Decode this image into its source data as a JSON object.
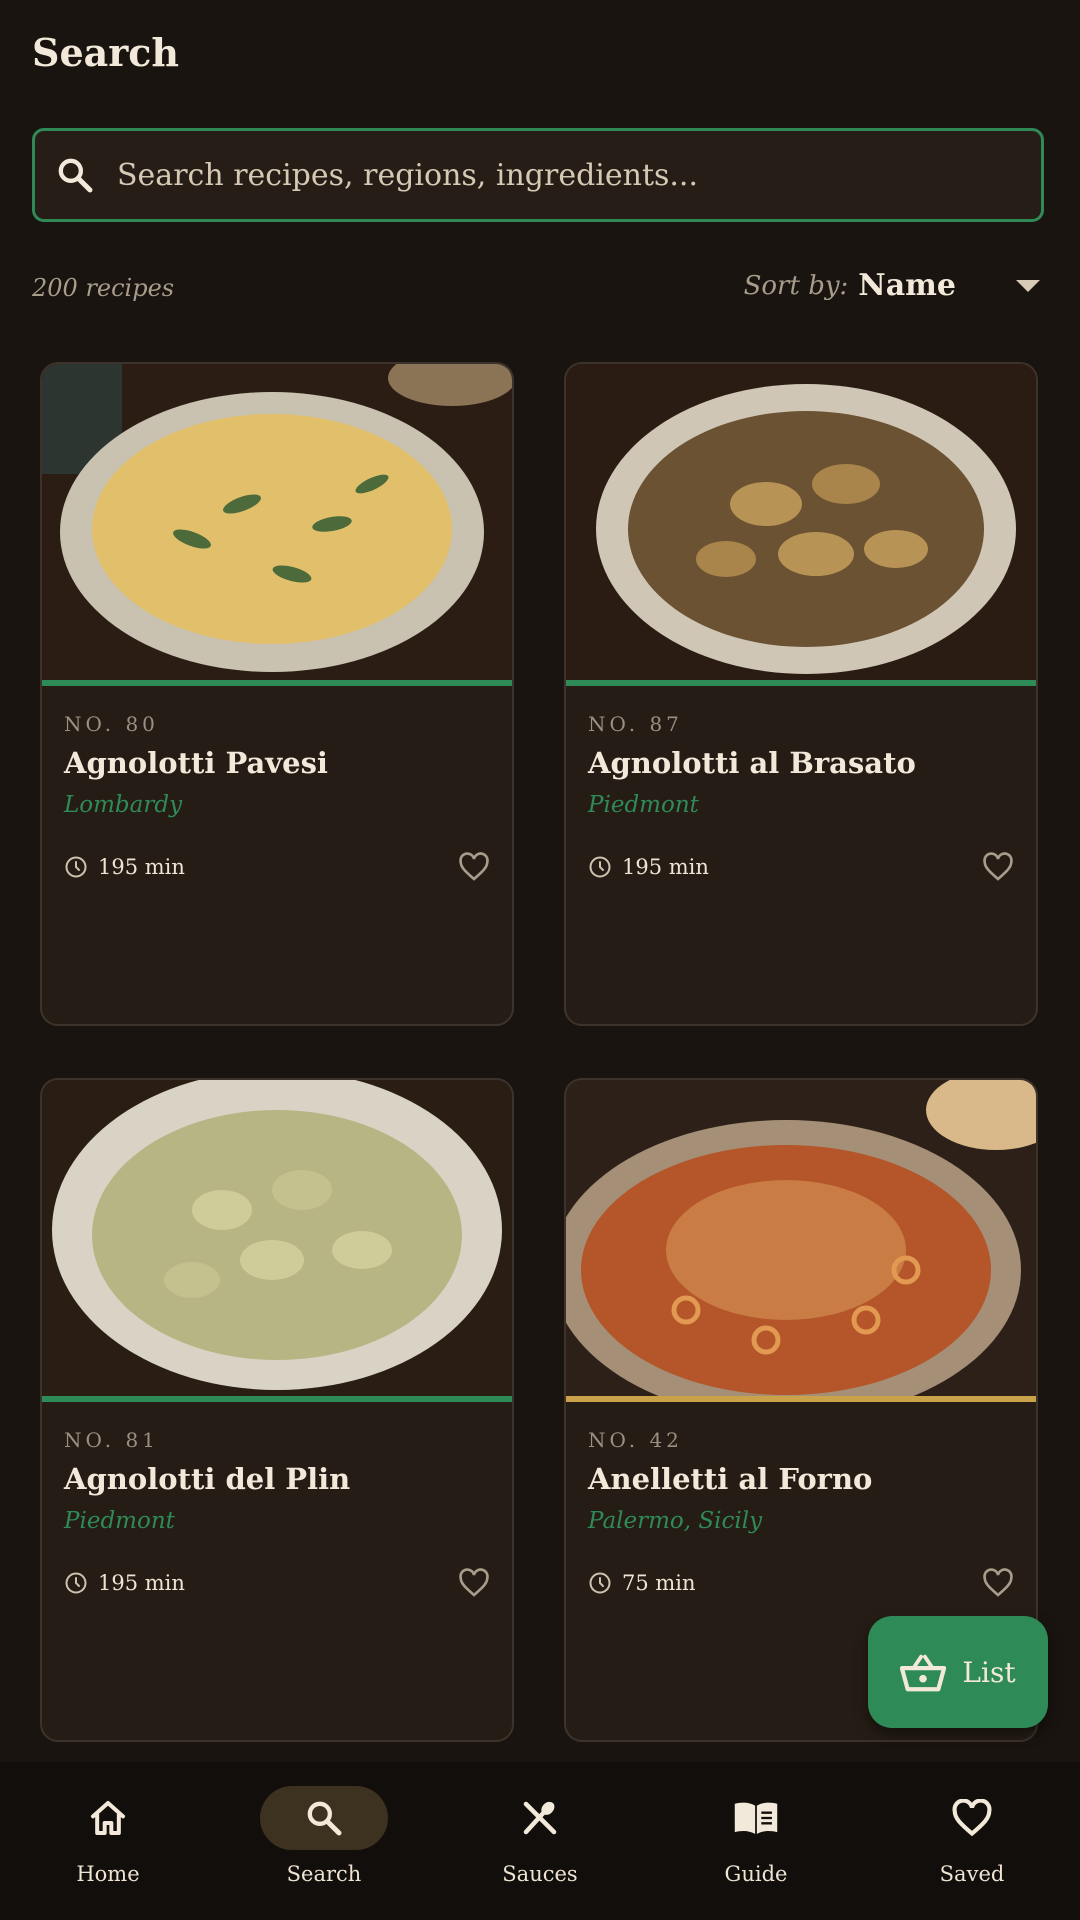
{
  "page": {
    "title": "Search"
  },
  "search": {
    "placeholder": "Search recipes, regions, ingredients..."
  },
  "results": {
    "count_label": "200 recipes"
  },
  "sort": {
    "label": "Sort by:",
    "value": "Name"
  },
  "recipes": [
    {
      "number": "NO. 80",
      "name": "Agnolotti Pavesi",
      "region": "Lombardy",
      "time": "195 min",
      "accent": "#2e8a57"
    },
    {
      "number": "NO. 87",
      "name": "Agnolotti al Brasato",
      "region": "Piedmont",
      "time": "195 min",
      "accent": "#2e8a57"
    },
    {
      "number": "NO. 81",
      "name": "Agnolotti del Plin",
      "region": "Piedmont",
      "time": "195 min",
      "accent": "#2e8a57"
    },
    {
      "number": "NO. 42",
      "name": "Anelletti al Forno",
      "region": "Palermo, Sicily",
      "time": "75 min",
      "accent": "#c9a24a"
    }
  ],
  "fab": {
    "label": "List",
    "icon": "basket-icon"
  },
  "nav": [
    {
      "label": "Home",
      "icon": "home-icon"
    },
    {
      "label": "Search",
      "icon": "search-icon",
      "active": true
    },
    {
      "label": "Sauces",
      "icon": "utensils-icon"
    },
    {
      "label": "Guide",
      "icon": "book-icon"
    },
    {
      "label": "Saved",
      "icon": "heart-icon"
    }
  ],
  "colors": {
    "accent_green": "#2e8a57",
    "accent_gold": "#c9a24a",
    "background": "#1a1410",
    "card": "#251d15"
  }
}
